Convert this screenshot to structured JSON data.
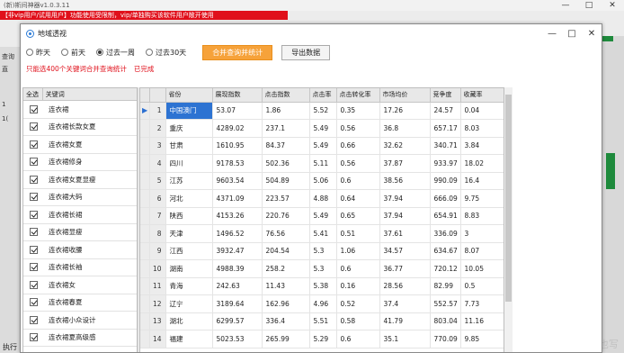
{
  "main_window": {
    "title": "(新)斯间神器v1.0.3.11",
    "controls": [
      "—",
      "□",
      "✕"
    ],
    "notice": "【非vip用户/试用用户】功能使用受限制，vip/单独购买该软件用户敞开使用",
    "side_labels": [
      "查询",
      "直",
      "1",
      "1(",
      "执行"
    ]
  },
  "dialog": {
    "title": "地域透视",
    "controls": [
      "—",
      "□",
      "✕"
    ],
    "radios": [
      {
        "label": "昨天",
        "checked": false
      },
      {
        "label": "前天",
        "checked": false
      },
      {
        "label": "过去一周",
        "checked": true
      },
      {
        "label": "过去30天",
        "checked": false
      }
    ],
    "merge_button": "合并查询并统计",
    "export_button": "导出数据",
    "hint": "只能选400个关键词合并查询统计",
    "status": "已完成"
  },
  "keyword_list": {
    "columns": [
      "全选",
      "关键词"
    ],
    "items": [
      "连衣裙",
      "连衣裙长款女夏",
      "连衣裙女夏",
      "连衣裙修身",
      "连衣裙女夏显瘦",
      "连衣裙大码",
      "连衣裙长裙",
      "连衣裙显瘦",
      "连衣裙收腰",
      "连衣裙长袖",
      "连衣裙女",
      "连衣裙春夏",
      "连衣裙小众设计",
      "连衣裙夏高级感"
    ]
  },
  "region_table": {
    "columns": [
      "",
      "",
      "省份",
      "展现指数",
      "点击指数",
      "点击率",
      "点击转化率",
      "市场均价",
      "竞争度",
      "收藏率"
    ],
    "rows": [
      {
        "idx": "1",
        "province": "中国澳门",
        "impression": "53.07",
        "click": "1.86",
        "ctr": "5.52",
        "cvr": "0.35",
        "price": "17.26",
        "competition": "24.57",
        "fav": "0.04",
        "selected": true
      },
      {
        "idx": "2",
        "province": "重庆",
        "impression": "4289.02",
        "click": "237.1",
        "ctr": "5.49",
        "cvr": "0.56",
        "price": "36.8",
        "competition": "657.17",
        "fav": "8.03"
      },
      {
        "idx": "3",
        "province": "甘肃",
        "impression": "1610.95",
        "click": "84.37",
        "ctr": "5.49",
        "cvr": "0.66",
        "price": "32.62",
        "competition": "340.71",
        "fav": "3.84"
      },
      {
        "idx": "4",
        "province": "四川",
        "impression": "9178.53",
        "click": "502.36",
        "ctr": "5.11",
        "cvr": "0.56",
        "price": "37.87",
        "competition": "933.97",
        "fav": "18.02"
      },
      {
        "idx": "5",
        "province": "江苏",
        "impression": "9603.54",
        "click": "504.89",
        "ctr": "5.06",
        "cvr": "0.6",
        "price": "38.56",
        "competition": "990.09",
        "fav": "16.4"
      },
      {
        "idx": "6",
        "province": "河北",
        "impression": "4371.09",
        "click": "223.57",
        "ctr": "4.88",
        "cvr": "0.64",
        "price": "37.94",
        "competition": "666.09",
        "fav": "9.75"
      },
      {
        "idx": "7",
        "province": "陕西",
        "impression": "4153.26",
        "click": "220.76",
        "ctr": "5.49",
        "cvr": "0.65",
        "price": "37.94",
        "competition": "654.91",
        "fav": "8.83"
      },
      {
        "idx": "8",
        "province": "天津",
        "impression": "1496.52",
        "click": "76.56",
        "ctr": "5.41",
        "cvr": "0.51",
        "price": "37.61",
        "competition": "336.09",
        "fav": "3"
      },
      {
        "idx": "9",
        "province": "江西",
        "impression": "3932.47",
        "click": "204.54",
        "ctr": "5.3",
        "cvr": "1.06",
        "price": "34.57",
        "competition": "634.67",
        "fav": "8.07"
      },
      {
        "idx": "10",
        "province": "湖南",
        "impression": "4988.39",
        "click": "258.2",
        "ctr": "5.3",
        "cvr": "0.6",
        "price": "36.77",
        "competition": "720.12",
        "fav": "10.05"
      },
      {
        "idx": "11",
        "province": "青海",
        "impression": "242.63",
        "click": "11.43",
        "ctr": "5.38",
        "cvr": "0.16",
        "price": "28.56",
        "competition": "82.99",
        "fav": "0.5"
      },
      {
        "idx": "12",
        "province": "辽宁",
        "impression": "3189.64",
        "click": "162.96",
        "ctr": "4.96",
        "cvr": "0.52",
        "price": "37.4",
        "competition": "552.57",
        "fav": "7.73"
      },
      {
        "idx": "13",
        "province": "湖北",
        "impression": "6299.57",
        "click": "336.4",
        "ctr": "5.51",
        "cvr": "0.58",
        "price": "41.79",
        "competition": "803.04",
        "fav": "11.16"
      },
      {
        "idx": "14",
        "province": "福建",
        "impression": "5023.53",
        "click": "265.99",
        "ctr": "5.29",
        "cvr": "0.6",
        "price": "35.1",
        "competition": "770.09",
        "fav": "9.85"
      }
    ]
  },
  "watermark": "〜 天是锁也写",
  "colors": {
    "accent_orange": "#f6a23a",
    "notice_red": "#e0101b",
    "selection_blue": "#2d73d2"
  }
}
